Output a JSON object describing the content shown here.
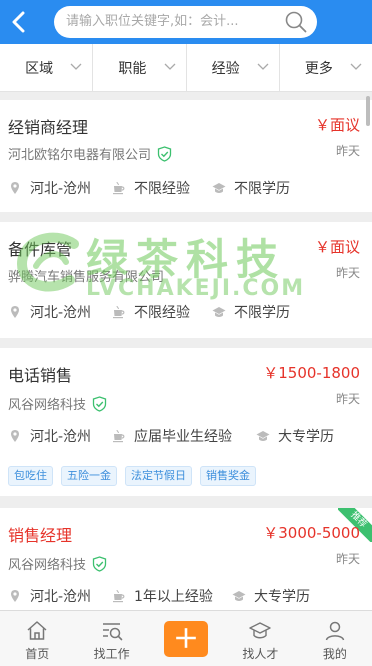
{
  "header": {
    "search_placeholder": "请输入职位关键字,如：会计..."
  },
  "filters": [
    {
      "label": "区域"
    },
    {
      "label": "职能"
    },
    {
      "label": "经验"
    },
    {
      "label": "更多"
    }
  ],
  "jobs": [
    {
      "title": "经销商经理",
      "salary": "￥面议",
      "company": "河北欧铭尔电器有限公司",
      "verified": true,
      "date": "昨天",
      "location": "河北-沧州",
      "experience": "不限经验",
      "education": "不限学历",
      "tags": []
    },
    {
      "title": "备件库管",
      "salary": "￥面议",
      "company": "骅腾汽车销售服务有限公司",
      "verified": false,
      "date": "昨天",
      "location": "河北-沧州",
      "experience": "不限经验",
      "education": "不限学历",
      "tags": []
    },
    {
      "title": "电话销售",
      "salary": "￥1500-1800",
      "company": "风谷网络科技",
      "verified": true,
      "date": "昨天",
      "location": "河北-沧州",
      "experience": "应届毕业生经验",
      "education": "大专学历",
      "tags": [
        "包吃住",
        "五险一金",
        "法定节假日",
        "销售奖金"
      ]
    },
    {
      "title": "销售经理",
      "salary": "￥3000-5000",
      "company": "风谷网络科技",
      "verified": true,
      "date": "昨天",
      "location": "河北-沧州",
      "experience": "1年以上经验",
      "education": "大专学历",
      "badge": "推荐",
      "tags": []
    }
  ],
  "watermark": {
    "main": "绿茶科技",
    "sub": "LVCHAKEJI.COM"
  },
  "nav": [
    {
      "label": "首页",
      "icon": "home-icon"
    },
    {
      "label": "找工作",
      "icon": "find-job-icon"
    },
    {
      "label": "",
      "icon": "plus-icon"
    },
    {
      "label": "找人才",
      "icon": "find-talent-icon"
    },
    {
      "label": "我的",
      "icon": "profile-icon"
    }
  ],
  "colors": {
    "header": "#2a8cf0",
    "salary": "#e6332a",
    "verified": "#3cc06f",
    "plus": "#ff8a1e"
  }
}
